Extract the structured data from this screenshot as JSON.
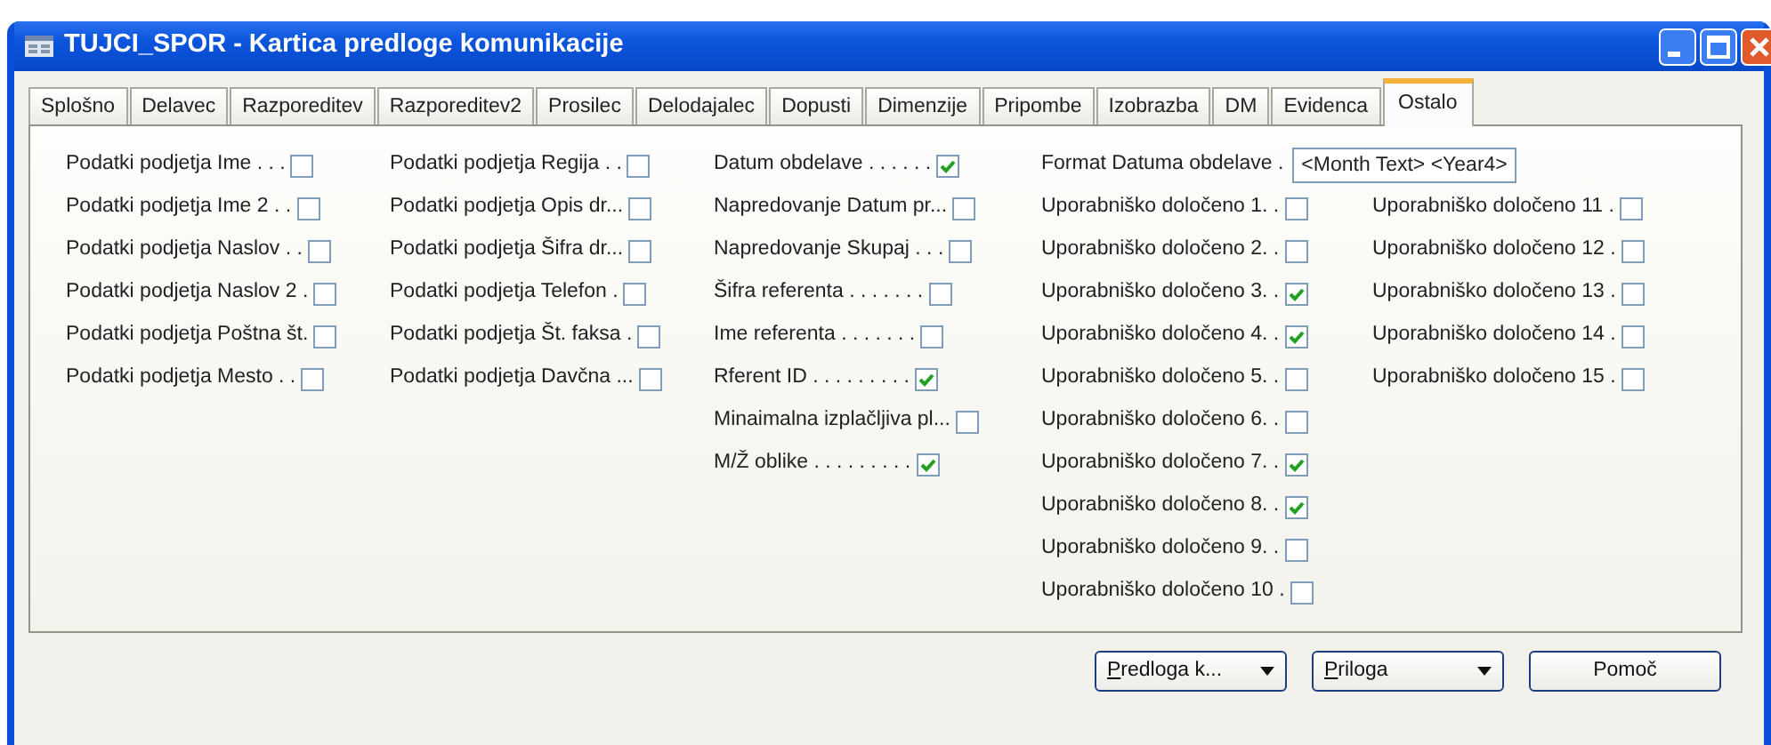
{
  "window": {
    "title": "TUJCI_SPOR - Kartica predloge komunikacije"
  },
  "tabs": [
    {
      "label": "Splošno",
      "selected": false
    },
    {
      "label": "Delavec",
      "selected": false
    },
    {
      "label": "Razporeditev",
      "selected": false
    },
    {
      "label": "Razporeditev2",
      "selected": false
    },
    {
      "label": "Prosilec",
      "selected": false
    },
    {
      "label": "Delodajalec",
      "selected": false
    },
    {
      "label": "Dopusti",
      "selected": false
    },
    {
      "label": "Dimenzije",
      "selected": false
    },
    {
      "label": "Pripombe",
      "selected": false
    },
    {
      "label": "Izobrazba",
      "selected": false
    },
    {
      "label": "DM",
      "selected": false
    },
    {
      "label": "Evidenca",
      "selected": false
    },
    {
      "label": "Ostalo",
      "selected": true
    }
  ],
  "columns": [
    [
      {
        "kind": "check",
        "label": "Podatki podjetja Ime . . .",
        "checked": false
      },
      {
        "kind": "check",
        "label": "Podatki podjetja Ime 2 . .",
        "checked": false
      },
      {
        "kind": "check",
        "label": "Podatki podjetja Naslov . .",
        "checked": false
      },
      {
        "kind": "check",
        "label": "Podatki podjetja Naslov 2 .",
        "checked": false
      },
      {
        "kind": "check",
        "label": "Podatki podjetja Poštna št.",
        "checked": false
      },
      {
        "kind": "check",
        "label": "Podatki podjetja Mesto . .",
        "checked": false
      }
    ],
    [
      {
        "kind": "check",
        "label": "Podatki podjetja Regija . .",
        "checked": false
      },
      {
        "kind": "check",
        "label": "Podatki podjetja Opis dr...",
        "checked": false
      },
      {
        "kind": "check",
        "label": "Podatki podjetja Šifra dr...",
        "checked": false
      },
      {
        "kind": "check",
        "label": "Podatki podjetja Telefon .",
        "checked": false
      },
      {
        "kind": "check",
        "label": "Podatki podjetja Št. faksa .",
        "checked": false
      },
      {
        "kind": "check",
        "label": "Podatki podjetja Davčna ...",
        "checked": false
      }
    ],
    [
      {
        "kind": "check",
        "label": "Datum obdelave . . . . . .",
        "checked": true
      },
      {
        "kind": "check",
        "label": "Napredovanje Datum pr...",
        "checked": false
      },
      {
        "kind": "check",
        "label": "Napredovanje Skupaj . . .",
        "checked": false
      },
      {
        "kind": "check",
        "label": "Šifra referenta . . . . . . .",
        "checked": false
      },
      {
        "kind": "check",
        "label": "Ime referenta . . . . . . .",
        "checked": false
      },
      {
        "kind": "check",
        "label": "Rferent ID . . . . . . . . .",
        "checked": true
      },
      {
        "kind": "check",
        "label": "Minaimalna izplačljiva pl...",
        "checked": false
      },
      {
        "kind": "check",
        "label": "M/Ž oblike . . . . . . . . .",
        "checked": true
      }
    ],
    [
      {
        "kind": "text",
        "label": "Format Datuma obdelave .",
        "value": "<Month Text> <Year4>"
      },
      {
        "kind": "check",
        "label": "Uporabniško določeno 1. .",
        "checked": false
      },
      {
        "kind": "check",
        "label": "Uporabniško določeno 2. .",
        "checked": false
      },
      {
        "kind": "check",
        "label": "Uporabniško določeno 3. .",
        "checked": true
      },
      {
        "kind": "check",
        "label": "Uporabniško določeno 4. .",
        "checked": true
      },
      {
        "kind": "check",
        "label": "Uporabniško določeno 5. .",
        "checked": false
      },
      {
        "kind": "check",
        "label": "Uporabniško določeno 6. .",
        "checked": false
      },
      {
        "kind": "check",
        "label": "Uporabniško določeno 7. .",
        "checked": true
      },
      {
        "kind": "check",
        "label": "Uporabniško določeno 8. .",
        "checked": true
      },
      {
        "kind": "check",
        "label": "Uporabniško določeno 9. .",
        "checked": false
      },
      {
        "kind": "check",
        "label": "Uporabniško določeno 10 .",
        "checked": false
      }
    ],
    [
      {
        "kind": "spacer"
      },
      {
        "kind": "check",
        "label": "Uporabniško določeno 11 .",
        "checked": false
      },
      {
        "kind": "check",
        "label": "Uporabniško določeno 12 .",
        "checked": false
      },
      {
        "kind": "check",
        "label": "Uporabniško določeno 13 .",
        "checked": false
      },
      {
        "kind": "check",
        "label": "Uporabniško določeno 14 .",
        "checked": false
      },
      {
        "kind": "check",
        "label": "Uporabniško določeno 15 .",
        "checked": false
      }
    ]
  ],
  "buttons": [
    {
      "label": "Predloga k...",
      "access_key": true,
      "dropdown": true
    },
    {
      "label": "Priloga",
      "access_key": true,
      "dropdown": true
    },
    {
      "label": "Pomoč",
      "access_key": false,
      "dropdown": false
    }
  ]
}
